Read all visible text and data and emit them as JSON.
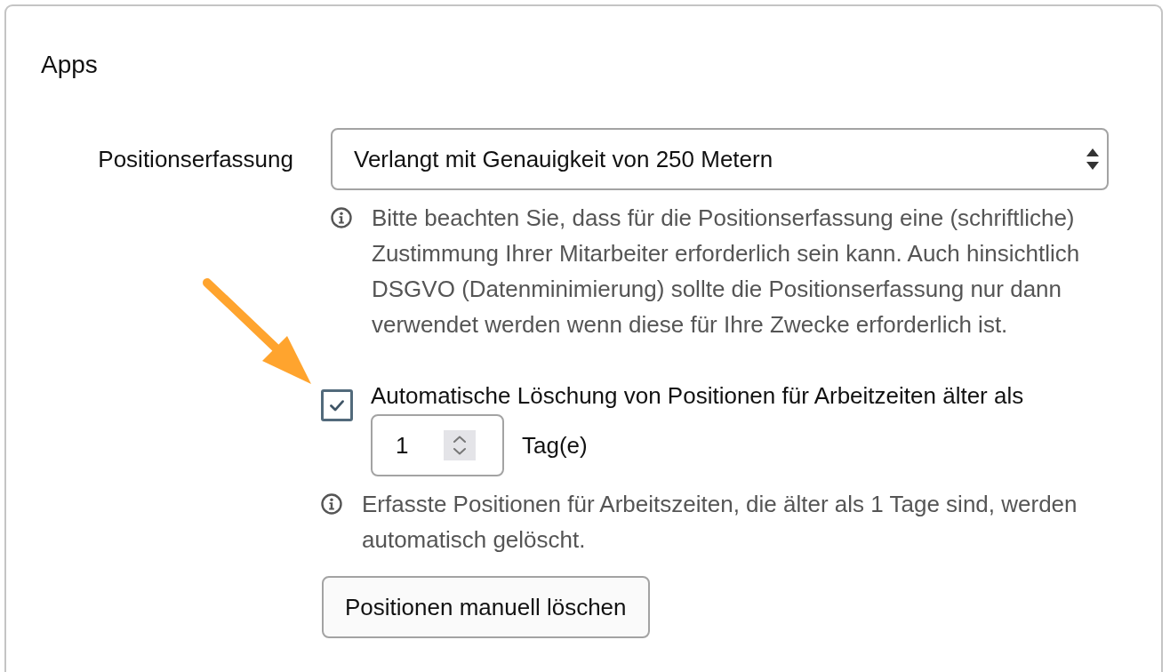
{
  "section_title": "Apps",
  "position_tracking": {
    "label": "Positionserfassung",
    "select": {
      "value": "Verlangt mit Genauigkeit von 250 Metern"
    },
    "hint": "Bitte beachten Sie, dass für die Positionserfassung eine (schriftliche) Zustimmung Ihrer Mitarbeiter erforderlich sein kann. Auch hinsichtlich DSGVO (Datenminimierung) sollte die Positionserfassung nur dann verwendet werden wenn diese für Ihre Zwecke erforderlich ist."
  },
  "auto_delete": {
    "checked": true,
    "label": "Automatische Löschung von Positionen für Arbeitzeiten älter als",
    "days": {
      "value": "1"
    },
    "unit": "Tag(e)",
    "hint": "Erfasste Positionen für Arbeitszeiten, die älter als 1 Tage sind, werden automatisch gelöscht."
  },
  "buttons": [
    {
      "label": "Positionen manuell löschen"
    }
  ]
}
